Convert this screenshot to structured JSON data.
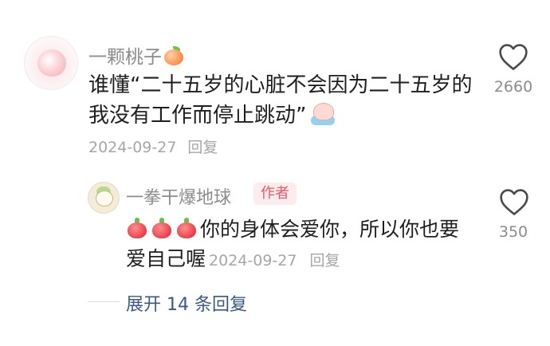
{
  "comment": {
    "username": "一颗桃子",
    "text_before_sticker": "谁懂“二十五岁的心脏不会因为二十五岁的我没有工作而停止跳动”",
    "date": "2024-09-27",
    "reply_label": "回复",
    "like_count": "2660"
  },
  "reply": {
    "username": "一拳干爆地球",
    "badge": "作者",
    "text": "你的身体会爱你，所以你也要爱自己喔",
    "date": "2024-09-27",
    "reply_label": "回复",
    "like_count": "350"
  },
  "expand": {
    "label": "展开 14 条回复"
  },
  "icons": {
    "like": "heart-outline-icon"
  },
  "colors": {
    "link": "#3a5a85",
    "badge_bg": "#fdecee",
    "badge_text": "#e05a6b"
  }
}
